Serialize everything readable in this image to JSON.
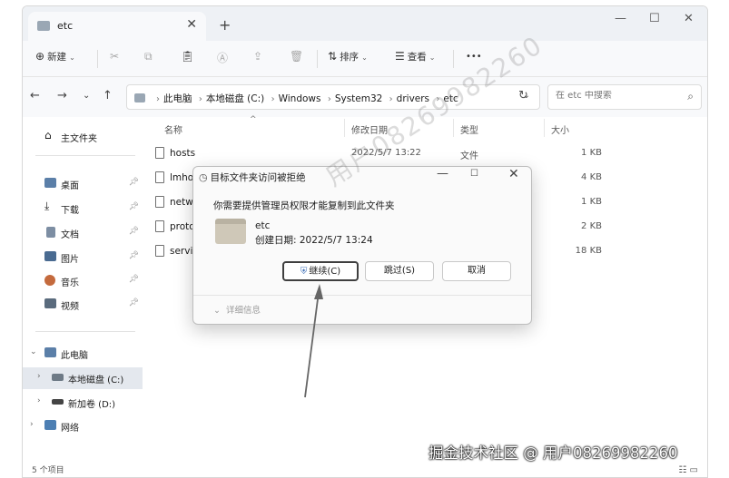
{
  "tab": {
    "title": "etc",
    "close_glyph": "✕",
    "new_tab_glyph": "+"
  },
  "window_controls": {
    "minimize": "—",
    "maximize": "☐",
    "close": "✕"
  },
  "toolbar": {
    "new_label": "新建",
    "sort_label": "排序",
    "view_label": "查看",
    "more_glyph": "•••"
  },
  "address": {
    "breadcrumbs": [
      "此电脑",
      "本地磁盘 (C:)",
      "Windows",
      "System32",
      "drivers",
      "etc"
    ],
    "search_placeholder": "在 etc 中搜索"
  },
  "sidebar": {
    "home": "主文件夹",
    "quick": [
      "桌面",
      "下载",
      "文档",
      "图片",
      "音乐",
      "视频"
    ],
    "this_pc": "此电脑",
    "local_disk": "本地磁盘 (C:)",
    "new_volume": "新加卷 (D:)",
    "network": "网络"
  },
  "columns": {
    "name": "名称",
    "modified": "修改日期",
    "type": "类型",
    "size": "大小"
  },
  "files": [
    {
      "name": "hosts",
      "date": "2022/5/7 13:22",
      "type": "文件",
      "size": "1 KB"
    },
    {
      "name": "lmho",
      "date": "",
      "type": "",
      "size": "4 KB"
    },
    {
      "name": "netw",
      "date": "",
      "type": "",
      "size": "1 KB"
    },
    {
      "name": "proto",
      "date": "",
      "type": "",
      "size": "2 KB"
    },
    {
      "name": "servi",
      "date": "",
      "type": "",
      "size": "18 KB"
    }
  ],
  "status": {
    "items": "5 个项目"
  },
  "dialog": {
    "title": "目标文件夹访问被拒绝",
    "message": "你需要提供管理员权限才能复制到此文件夹",
    "folder_name": "etc",
    "folder_date": "创建日期: 2022/5/7 13:24",
    "continue_label": "继续(C)",
    "skip_label": "跳过(S)",
    "cancel_label": "取消",
    "details_label": "详细信息"
  },
  "watermark": "用户08269982260",
  "credit": "掘金技术社区 @ 用户08269982260",
  "colors": {
    "accent": "#3d6fb6",
    "highlight_border": "#3f3f3f",
    "selected_nav": "#e4e8ee"
  }
}
